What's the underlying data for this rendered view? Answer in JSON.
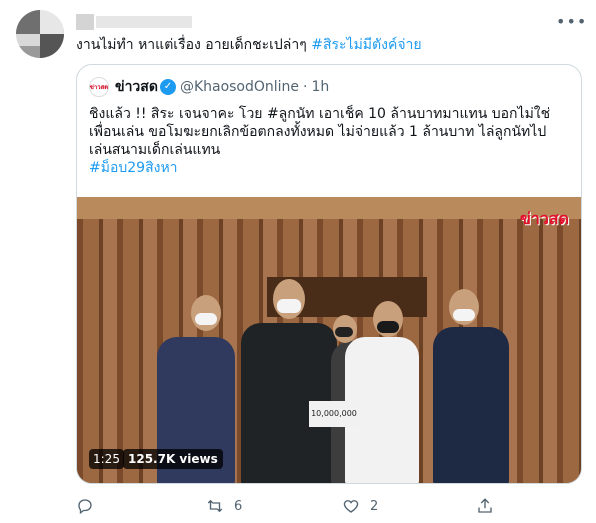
{
  "tweet": {
    "text": "งานไม่ทำ หาแต่เรื่อง อายเด็กชะเปล่าๆ ",
    "hashtag": "#สิระไม่มีตังค์จ่าย",
    "more_icon": "more-horizontal-icon"
  },
  "quote": {
    "logo_text": "ข่าวสด",
    "name": "ข่าวสด",
    "verified_icon": "verified-badge-icon",
    "handle": "@KhaosodOnline",
    "dot": "·",
    "time": "1h",
    "body_lines": [
      "ชิงแล้ว !! สิระ เจนจาคะ โวย #ลูกนัท เอาเช็ค 10 ล้านบาทมาแทน บอกไม่ใช่",
      "เพื่อนเล่น ขอโมฆะยกเลิกข้อตกลงทั้งหมด ไม่จ่ายแล้ว 1 ล้านบาท ไล่ลูกนัทไป",
      "เล่นสนามเด็กเล่นแทน",
      "#ม็อบ29สิงหา"
    ],
    "media": {
      "watermark": "ข่าวสด",
      "sign_text": "10,000,000",
      "duration": "1:25",
      "views": "125.7K views"
    }
  },
  "actions": {
    "reply_icon": "reply-icon",
    "retweet_icon": "retweet-icon",
    "retweet_count": "6",
    "like_icon": "heart-icon",
    "like_count": "2",
    "share_icon": "share-icon"
  },
  "colors": {
    "accent": "#1d9bf0",
    "text": "#0f1419",
    "muted": "#536471",
    "border": "#cfd9de",
    "watermark": "#e0102a"
  }
}
